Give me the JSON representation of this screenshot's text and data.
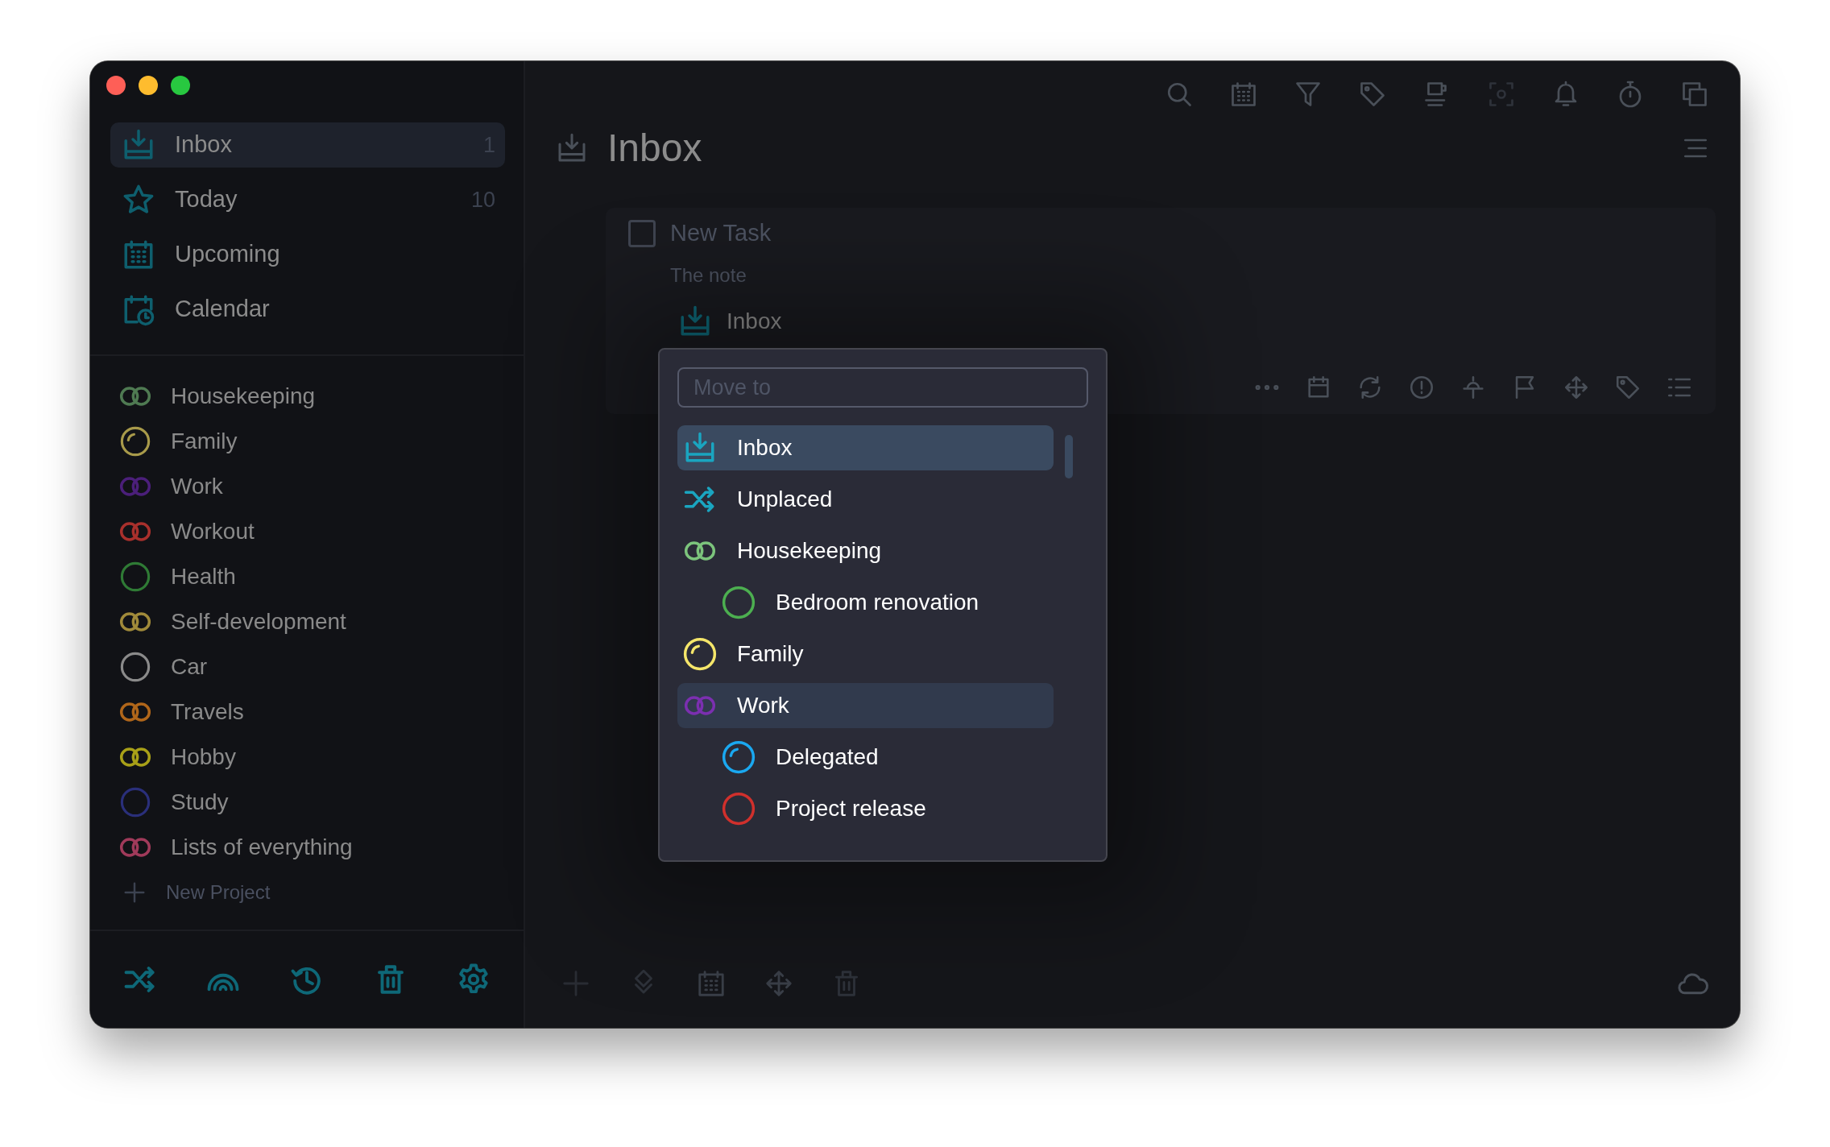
{
  "sidebar": {
    "nav": [
      {
        "label": "Inbox",
        "kind": "inbox",
        "count": "1",
        "selected": true
      },
      {
        "label": "Today",
        "kind": "star",
        "count": "10",
        "selected": false
      },
      {
        "label": "Upcoming",
        "kind": "calendar",
        "selected": false
      },
      {
        "label": "Calendar",
        "kind": "calendar-clock",
        "selected": false
      }
    ],
    "projects": [
      {
        "label": "Housekeeping",
        "kind": "double",
        "color": "#4f7a52"
      },
      {
        "label": "Family",
        "kind": "progress",
        "color": "#a89a4a"
      },
      {
        "label": "Work",
        "kind": "double",
        "color": "#4b1f7a"
      },
      {
        "label": "Workout",
        "kind": "double",
        "color": "#a8302c"
      },
      {
        "label": "Health",
        "kind": "ring",
        "color": "#2f7a35"
      },
      {
        "label": "Self-development",
        "kind": "double",
        "color": "#a08a3a"
      },
      {
        "label": "Car",
        "kind": "ring",
        "color": "#8a8a8a"
      },
      {
        "label": "Travels",
        "kind": "double",
        "color": "#b0661a"
      },
      {
        "label": "Hobby",
        "kind": "double",
        "color": "#a8a018"
      },
      {
        "label": "Study",
        "kind": "ring",
        "color": "#2a2f7a"
      },
      {
        "label": "Lists of everything",
        "kind": "double",
        "color": "#a03a5a"
      }
    ],
    "new_project": "New Project"
  },
  "main": {
    "title": "Inbox",
    "task": {
      "checked": false,
      "title_placeholder": "New Task",
      "note_placeholder": "The note",
      "project": "Inbox"
    },
    "move_menu": {
      "placeholder": "Move to",
      "items": [
        {
          "label": "Inbox",
          "kind": "inbox",
          "color": "#1aa5c0",
          "selected": true,
          "hovered": false
        },
        {
          "label": "Unplaced",
          "kind": "shuffle",
          "color": "#1aa5c0",
          "selected": false,
          "hovered": false
        },
        {
          "label": "Housekeeping",
          "kind": "double",
          "color": "#7cc47c",
          "selected": false,
          "hovered": false,
          "children": [
            {
              "label": "Bedroom renovation",
              "kind": "ring",
              "color": "#4caf50",
              "selected": false,
              "hovered": false
            }
          ]
        },
        {
          "label": "Family",
          "kind": "progress",
          "color": "#f5e66a",
          "selected": false,
          "hovered": false
        },
        {
          "label": "Work",
          "kind": "double",
          "color": "#7b2fb0",
          "selected": false,
          "hovered": true,
          "children": [
            {
              "label": "Delegated",
              "kind": "progress",
              "color": "#1aa8f0",
              "selected": false,
              "hovered": false
            },
            {
              "label": "Project release",
              "kind": "ring",
              "color": "#d0302c",
              "selected": false,
              "hovered": false
            }
          ]
        }
      ]
    }
  }
}
